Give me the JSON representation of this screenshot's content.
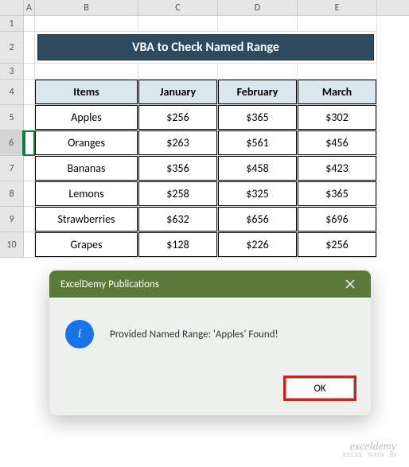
{
  "columns": [
    "A",
    "B",
    "C",
    "D",
    "E"
  ],
  "rows": [
    "1",
    "2",
    "3",
    "4",
    "5",
    "6",
    "7",
    "8",
    "9",
    "10"
  ],
  "selectedRow": "6",
  "title": "VBA to Check Named Range",
  "table": {
    "headers": [
      "Items",
      "January",
      "February",
      "March"
    ],
    "data": [
      {
        "item": "Apples",
        "jan": "$256",
        "feb": "$365",
        "mar": "$302"
      },
      {
        "item": "Oranges",
        "jan": "$263",
        "feb": "$561",
        "mar": "$456"
      },
      {
        "item": "Bananas",
        "jan": "$356",
        "feb": "$458",
        "mar": "$423"
      },
      {
        "item": "Lemons",
        "jan": "$258",
        "feb": "$325",
        "mar": "$365"
      },
      {
        "item": "Strawberries",
        "jan": "$632",
        "feb": "$656",
        "mar": "$696"
      },
      {
        "item": "Grapes",
        "jan": "$128",
        "feb": "$226",
        "mar": "$256"
      }
    ]
  },
  "dialog": {
    "title": "ExcelDemy Publications",
    "message": "Provided Named Range: 'Apples' Found!",
    "ok": "OK"
  },
  "watermark": {
    "main": "exceldemy",
    "sub": "EXCEL · DATA · BI"
  }
}
